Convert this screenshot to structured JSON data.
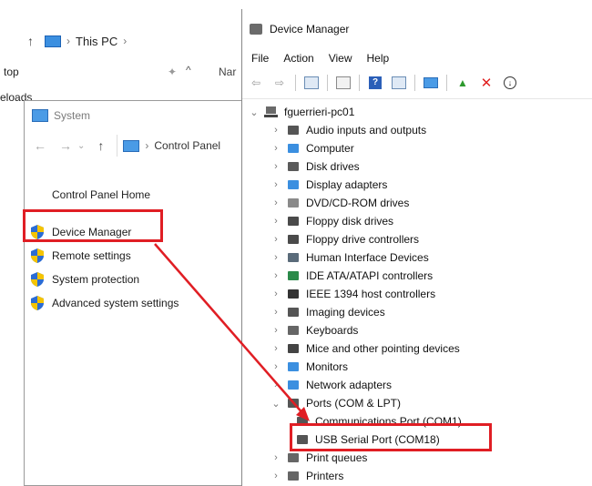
{
  "explorer": {
    "breadcrumb": "This PC",
    "sidebar_item": "top",
    "name_col": "Nar",
    "partial_item": "eloads"
  },
  "system": {
    "title": "System",
    "path": "Control Panel",
    "home": "Control Panel Home",
    "links": [
      "Device Manager",
      "Remote settings",
      "System protection",
      "Advanced system settings"
    ]
  },
  "devmgr": {
    "title": "Device Manager",
    "menu": [
      "File",
      "Action",
      "View",
      "Help"
    ],
    "root": "fguerrieri-pc01",
    "nodes": [
      {
        "label": "Audio inputs and outputs",
        "icon": "speaker-icon"
      },
      {
        "label": "Computer",
        "icon": "computer-icon"
      },
      {
        "label": "Disk drives",
        "icon": "disk-drive-icon"
      },
      {
        "label": "Display adapters",
        "icon": "display-adapter-icon"
      },
      {
        "label": "DVD/CD-ROM drives",
        "icon": "dvd-icon"
      },
      {
        "label": "Floppy disk drives",
        "icon": "floppy-icon"
      },
      {
        "label": "Floppy drive controllers",
        "icon": "floppy-controller-icon"
      },
      {
        "label": "Human Interface Devices",
        "icon": "hid-icon"
      },
      {
        "label": "IDE ATA/ATAPI controllers",
        "icon": "ide-icon"
      },
      {
        "label": "IEEE 1394 host controllers",
        "icon": "firewire-icon"
      },
      {
        "label": "Imaging devices",
        "icon": "camera-icon"
      },
      {
        "label": "Keyboards",
        "icon": "keyboard-icon"
      },
      {
        "label": "Mice and other pointing devices",
        "icon": "mouse-icon"
      },
      {
        "label": "Monitors",
        "icon": "monitor-icon"
      },
      {
        "label": "Network adapters",
        "icon": "network-icon"
      },
      {
        "label": "Ports (COM & LPT)",
        "icon": "port-icon"
      },
      {
        "label": "Communications Port (COM1)",
        "icon": "port-icon"
      },
      {
        "label": "USB Serial Port (COM18)",
        "icon": "port-icon"
      },
      {
        "label": "Print queues",
        "icon": "printer-icon"
      },
      {
        "label": "Printers",
        "icon": "printer-icon"
      }
    ]
  },
  "colors": {
    "highlight": "#e01e24",
    "shield_blue": "#2b6cd4",
    "shield_yellow": "#f5c400"
  }
}
